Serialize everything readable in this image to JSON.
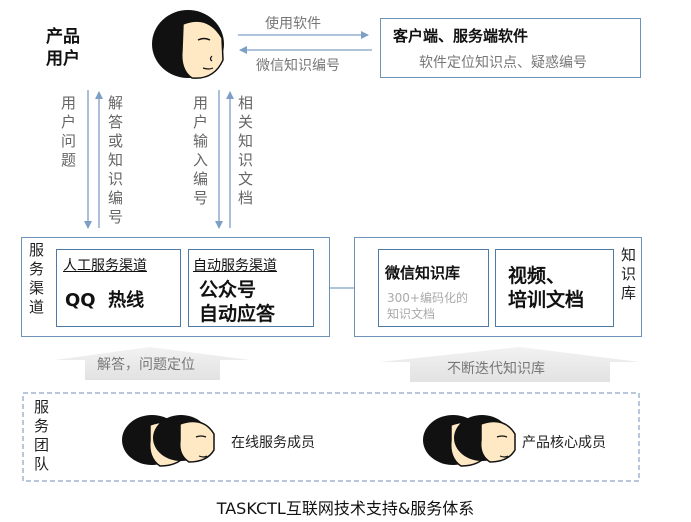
{
  "product_user": {
    "line1": "产品",
    "line2": "用户"
  },
  "top_arrows": {
    "use_software": "使用软件",
    "wechat_code": "微信知识编号"
  },
  "client_box": {
    "title": "客户端、服务端软件",
    "subtitle": "软件定位知识点、疑惑编号"
  },
  "vertical_labels": {
    "user_question": "用户问题",
    "answer_or_code": "解答或知识编号",
    "user_input_code": "用户输入编号",
    "related_docs": "相关知识文档"
  },
  "service_channel": {
    "label": "服务渠道",
    "manual": {
      "title": "人工服务渠道",
      "content": "QQ  热线"
    },
    "auto": {
      "title": "自动服务渠道",
      "line1": "公众号",
      "line2": "自动应答"
    }
  },
  "knowledge_base": {
    "label": "知识库",
    "wechat": {
      "title": "微信知识库",
      "sub1": "300+编码化的",
      "sub2": "知识文档"
    },
    "video": {
      "line1": "视频、",
      "line2": "培训文档"
    }
  },
  "mid_arrows": {
    "left": "解答，问题定位",
    "right": "不断迭代知识库"
  },
  "service_team": {
    "label": "服务团队",
    "online_members": "在线服务成员",
    "core_members": "产品核心成员"
  },
  "caption": "TASKCTL互联网技术支持&服务体系",
  "colors": {
    "border": "#6f92b8",
    "arrow": "#7d9fc6",
    "hair": "#111111",
    "face": "#ffe9c4"
  }
}
